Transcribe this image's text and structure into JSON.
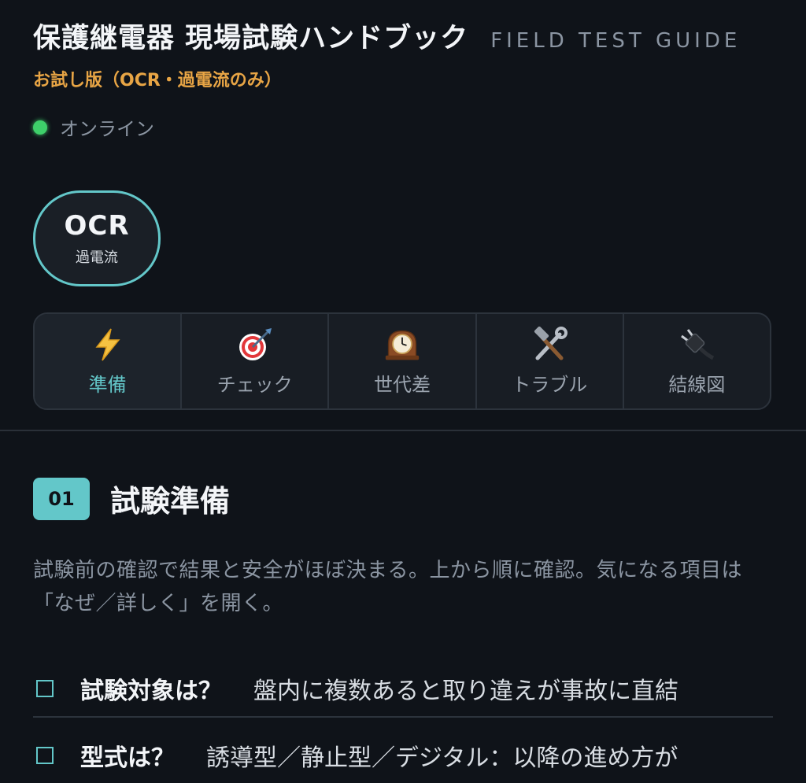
{
  "header": {
    "title": "保護継電器 現場試験ハンドブック",
    "title_en": "FIELD TEST GUIDE",
    "subtitle": "お試し版（OCR・過電流のみ）",
    "status": "オンライン",
    "status_color": "#3ecf6a"
  },
  "relay": {
    "code": "OCR",
    "name": "過電流"
  },
  "tabs": [
    {
      "icon": "lightning-icon",
      "label": "準備",
      "active": true
    },
    {
      "icon": "target-icon",
      "label": "チェック",
      "active": false
    },
    {
      "icon": "clock-icon",
      "label": "世代差",
      "active": false
    },
    {
      "icon": "tools-icon",
      "label": "トラブル",
      "active": false
    },
    {
      "icon": "plug-icon",
      "label": "結線図",
      "active": false
    }
  ],
  "section": {
    "number": "01",
    "title": "試験準備",
    "description": "試験前の確認で結果と安全がほぼ決まる。上から順に確認。気になる項目は「なぜ／詳しく」を開く。"
  },
  "checklist": [
    {
      "title": "試験対象は？",
      "note": "盤内に複数あると取り違えが事故に直結"
    },
    {
      "title": "型式は？",
      "note": "誘導型／静止型／デジタル：以降の進め方が"
    }
  ],
  "colors": {
    "accent": "#63c7c9",
    "warning": "#e8a545",
    "background": "#0f1319"
  }
}
